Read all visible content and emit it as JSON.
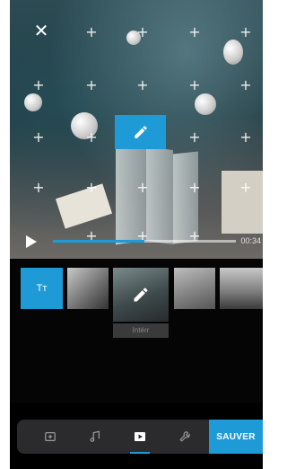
{
  "preview": {
    "elapsed_time": "00:34",
    "progress": 0.5
  },
  "timeline": {
    "text_clip_label": "Tт",
    "selected_clip_label": "Intérr"
  },
  "toolbar": {
    "tools": [
      "add-media-icon",
      "music-icon",
      "clips-icon",
      "settings-icon"
    ],
    "save_label": "SAUVER"
  },
  "colors": {
    "accent": "#1e9bd7",
    "toolbar_bg": "#2b2b2d",
    "background": "#000000"
  }
}
